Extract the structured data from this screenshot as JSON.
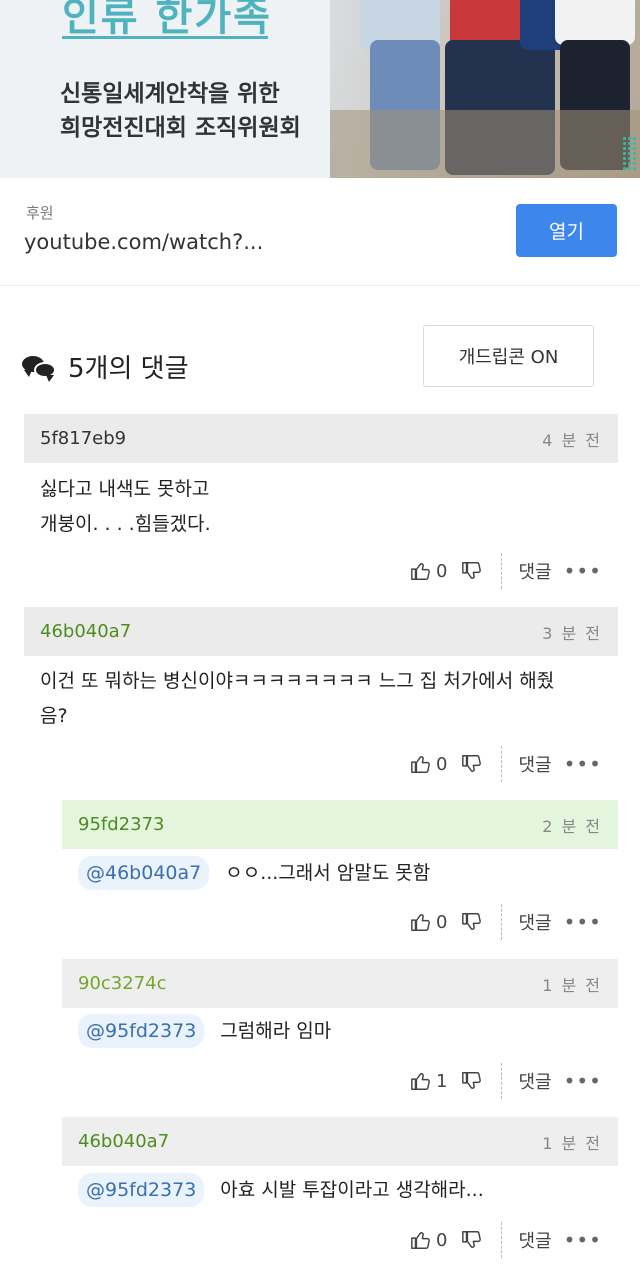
{
  "banner": {
    "title": "인류 한가족",
    "line1": "신통일세계안착을 위한",
    "line2": "희망전진대회 조직위원회"
  },
  "sponsor": {
    "label": "후원",
    "url": "youtube.com/watch?...",
    "open_label": "열기"
  },
  "comments_section": {
    "title": "5개의 댓글",
    "emoticon_toggle": "개드립콘 ON"
  },
  "comments": [
    {
      "author": "5f817eb9",
      "time": "4 분 전",
      "lines": [
        "싫다고 내색도 못하고",
        "개붕이. . . .힘들겠다."
      ],
      "likes": "0",
      "reply_label": "댓글",
      "more": "•••"
    },
    {
      "author": "46b040a7",
      "time": "3 분 전",
      "lines": [
        "이건 또 뭐하는 병신이야ㅋㅋㅋㅋㅋㅋㅋㅋ 느그 집 처가에서 해줬",
        "음?"
      ],
      "likes": "0",
      "reply_label": "댓글",
      "more": "•••"
    },
    {
      "author": "95fd2373",
      "time": "2 분 전",
      "mention": "@46b040a7",
      "text": "ㅇㅇ...그래서 암말도 못함",
      "likes": "0",
      "reply_label": "댓글",
      "more": "•••"
    },
    {
      "author": "90c3274c",
      "time": "1 분 전",
      "mention": "@95fd2373",
      "text": "그럼해라 임마",
      "likes": "1",
      "reply_label": "댓글",
      "more": "•••"
    },
    {
      "author": "46b040a7",
      "time": "1 분 전",
      "mention": "@95fd2373",
      "text": "아효 시발 투잡이라고 생각해라...",
      "likes": "0",
      "reply_label": "댓글",
      "more": "•••"
    }
  ],
  "icons": {
    "thumb_up": "thumbs-up-icon",
    "thumb_down": "thumbs-down-icon",
    "comments": "chat-bubbles-icon"
  },
  "colors": {
    "open_button": "#3d86ec",
    "accent_teal": "#4fb3bf",
    "author_green": "#4d8c1f",
    "reply_highlight": "#e3f5dd"
  }
}
